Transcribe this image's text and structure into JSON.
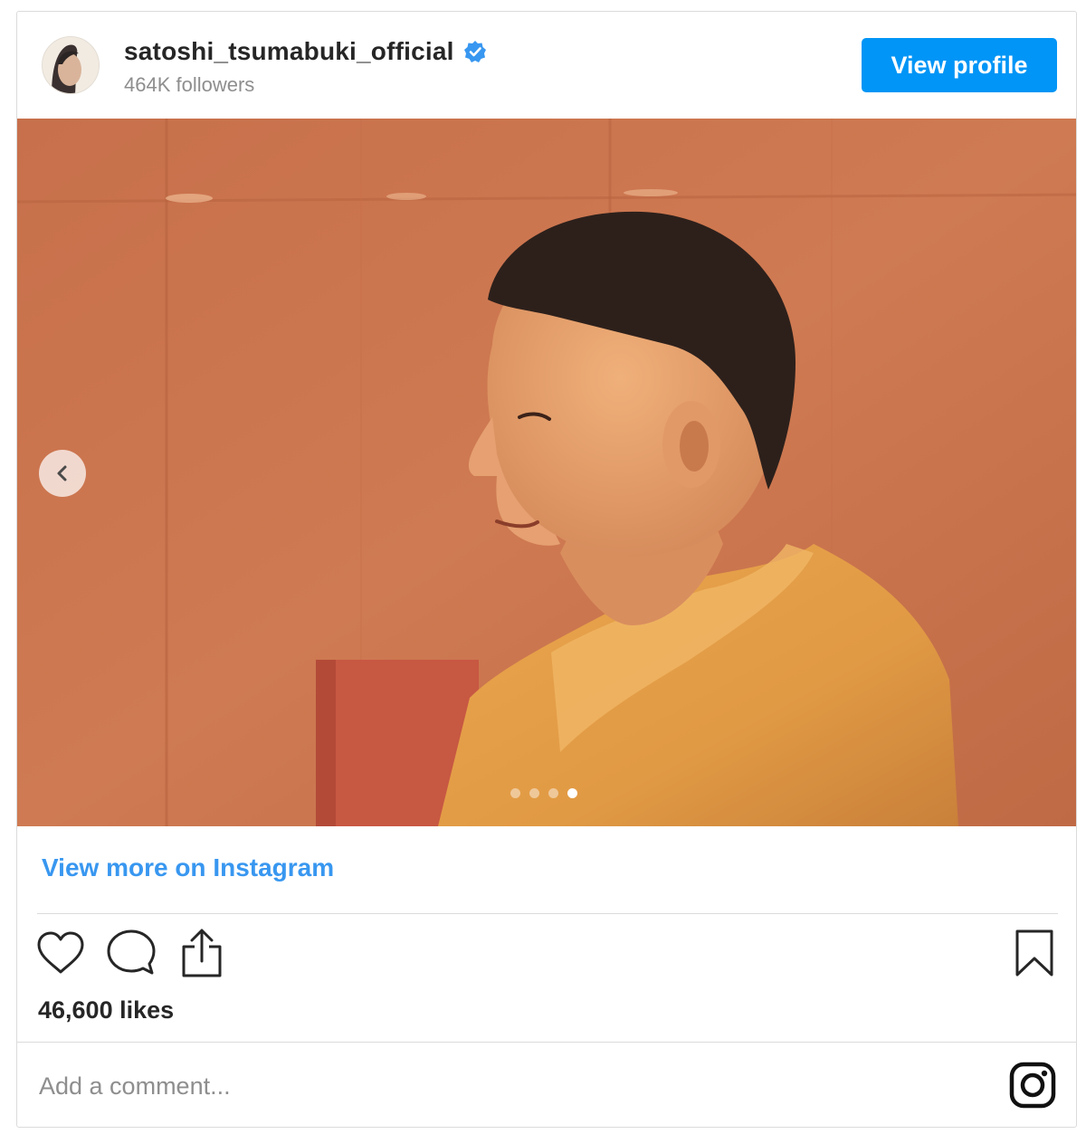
{
  "post": {
    "username": "satoshi_tsumabuki_official",
    "followers": "464K followers",
    "view_profile_label": "View profile",
    "view_more_label": "View more on Instagram",
    "likes": "46,600 likes",
    "comment_placeholder": "Add a comment...",
    "carousel": {
      "slide_count": 4,
      "active_index": 3
    },
    "accent_color": "#0095f6",
    "link_color": "#3897f0"
  },
  "icons": {
    "verified": "verified-badge-icon",
    "prev": "chevron-left-icon",
    "like": "heart-icon",
    "comment": "comment-bubble-icon",
    "share": "share-upload-icon",
    "save": "bookmark-icon",
    "brand": "instagram-glyph-icon"
  }
}
